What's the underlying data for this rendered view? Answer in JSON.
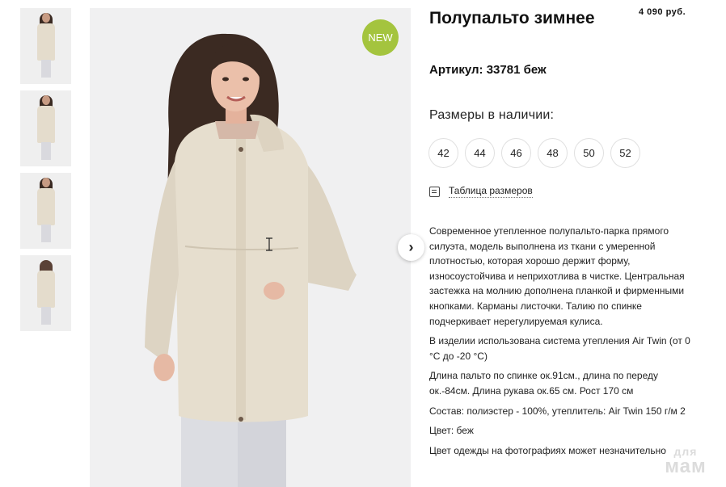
{
  "product": {
    "title": "Полупальто зимнее",
    "price": "4 090 руб.",
    "sku": "Артикул: 33781 беж",
    "badge": "NEW"
  },
  "sizes": {
    "label": "Размеры в наличии:",
    "options": [
      "42",
      "44",
      "46",
      "48",
      "50",
      "52"
    ]
  },
  "size_table": {
    "label": "Таблица размеров",
    "icon": "table-icon"
  },
  "description": {
    "p1": "Современное утепленное полупальто-парка прямого силуэта, модель выполнена из ткани с умеренной плотностью, которая хорошо держит форму, износоустойчива и неприхотлива в чистке. Центральная застежка на молнию дополнена планкой и фирменными кнопками. Карманы листочки. Талию по спинке подчеркивает нерегулируемая кулиса.",
    "p2": "В изделии использована система утепления Air Twin (от 0 °C до -20 °C)",
    "p3": "Длина пальто по спинке ок.91см., длина по переду ок.-84см. Длина рукава ок.65 см. Рост 170 см",
    "p4": "Состав: полиэстер - 100%, утеплитель: Air Twin 150 г/м 2",
    "p5": "Цвет: беж",
    "p6": "Цвет одежды на фотографиях может незначительно"
  },
  "gallery": {
    "next_icon": "chevron-right-icon",
    "thumbnails": [
      "thumb-1",
      "thumb-2",
      "thumb-3",
      "thumb-4"
    ]
  },
  "watermark": {
    "line1": "для",
    "line2": "мам"
  },
  "colors": {
    "badge": "#a4c43e",
    "coat": "#e4dccc",
    "background": "#f0f0f1"
  }
}
